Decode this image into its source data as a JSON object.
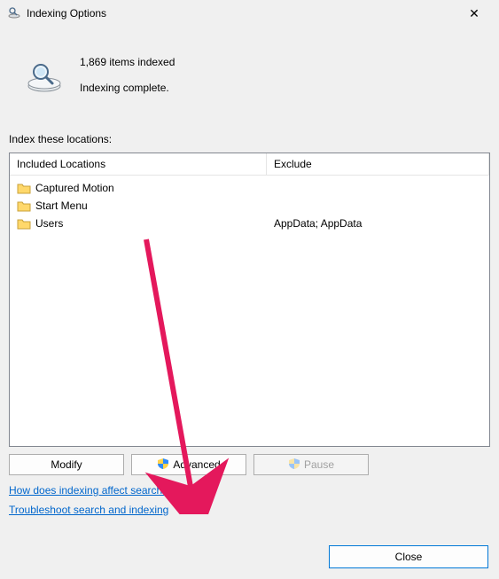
{
  "window": {
    "title": "Indexing Options"
  },
  "status": {
    "count_text": "1,869 items indexed",
    "state_text": "Indexing complete."
  },
  "locations_label": "Index these locations:",
  "columns": {
    "included": "Included Locations",
    "exclude": "Exclude"
  },
  "rows": [
    {
      "name": "Captured Motion",
      "exclude": ""
    },
    {
      "name": "Start Menu",
      "exclude": ""
    },
    {
      "name": "Users",
      "exclude": "AppData; AppData"
    }
  ],
  "buttons": {
    "modify": "Modify",
    "advanced": "Advanced",
    "pause": "Pause",
    "close": "Close"
  },
  "links": {
    "help": "How does indexing affect searches?",
    "troubleshoot": "Troubleshoot search and indexing"
  }
}
